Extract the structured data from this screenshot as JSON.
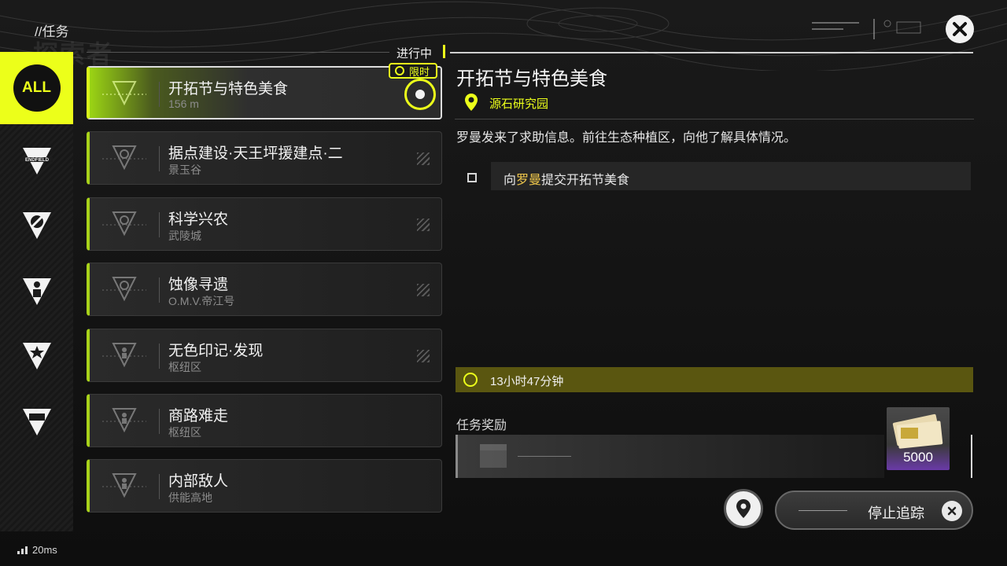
{
  "header": {
    "breadcrumb": "//任务",
    "watermark": "探索者"
  },
  "categories": [
    {
      "id": "all",
      "label": "ALL",
      "icon": "all-badge",
      "active": true
    },
    {
      "id": "endfield",
      "label": "ENDFIELD",
      "icon": "endfield-icon",
      "active": false
    },
    {
      "id": "explore",
      "label": "",
      "icon": "compass-icon",
      "active": false
    },
    {
      "id": "character",
      "label": "",
      "icon": "person-icon",
      "active": false
    },
    {
      "id": "star",
      "label": "",
      "icon": "star-icon",
      "active": false
    },
    {
      "id": "daily",
      "label": "",
      "icon": "battery-icon",
      "active": false
    }
  ],
  "list": {
    "status_label": "进行中",
    "quests": [
      {
        "title": "开拓节与特色美食",
        "subtitle": "156 m",
        "active": true,
        "badge": "限时"
      },
      {
        "title": "据点建设·天王坪援建点·二",
        "subtitle": "景玉谷",
        "active": false
      },
      {
        "title": "科学兴农",
        "subtitle": "武陵城",
        "active": false
      },
      {
        "title": "蚀像寻遗",
        "subtitle": "O.M.V.帝江号",
        "active": false
      },
      {
        "title": "无色印记·发现",
        "subtitle": "枢纽区",
        "active": false
      },
      {
        "title": "商路难走",
        "subtitle": "枢纽区",
        "active": false
      },
      {
        "title": "内部敌人",
        "subtitle": "供能高地",
        "active": false
      }
    ]
  },
  "detail": {
    "title": "开拓节与特色美食",
    "location": "源石研究园",
    "description": "罗曼发来了求助信息。前往生态种植区，向他了解具体情况。",
    "objective": {
      "prefix": "向",
      "highlight": "罗曼",
      "suffix": "提交开拓节美食"
    },
    "timer": "13小时47分钟",
    "reward_label": "任务奖励",
    "reward_quantity": "5000"
  },
  "actions": {
    "stop_tracking": "停止追踪"
  },
  "status": {
    "ping": "20ms"
  },
  "colors": {
    "accent": "#ecff1a",
    "highlight": "#f2c94c",
    "reward_rarity": "#6a3aa8"
  }
}
